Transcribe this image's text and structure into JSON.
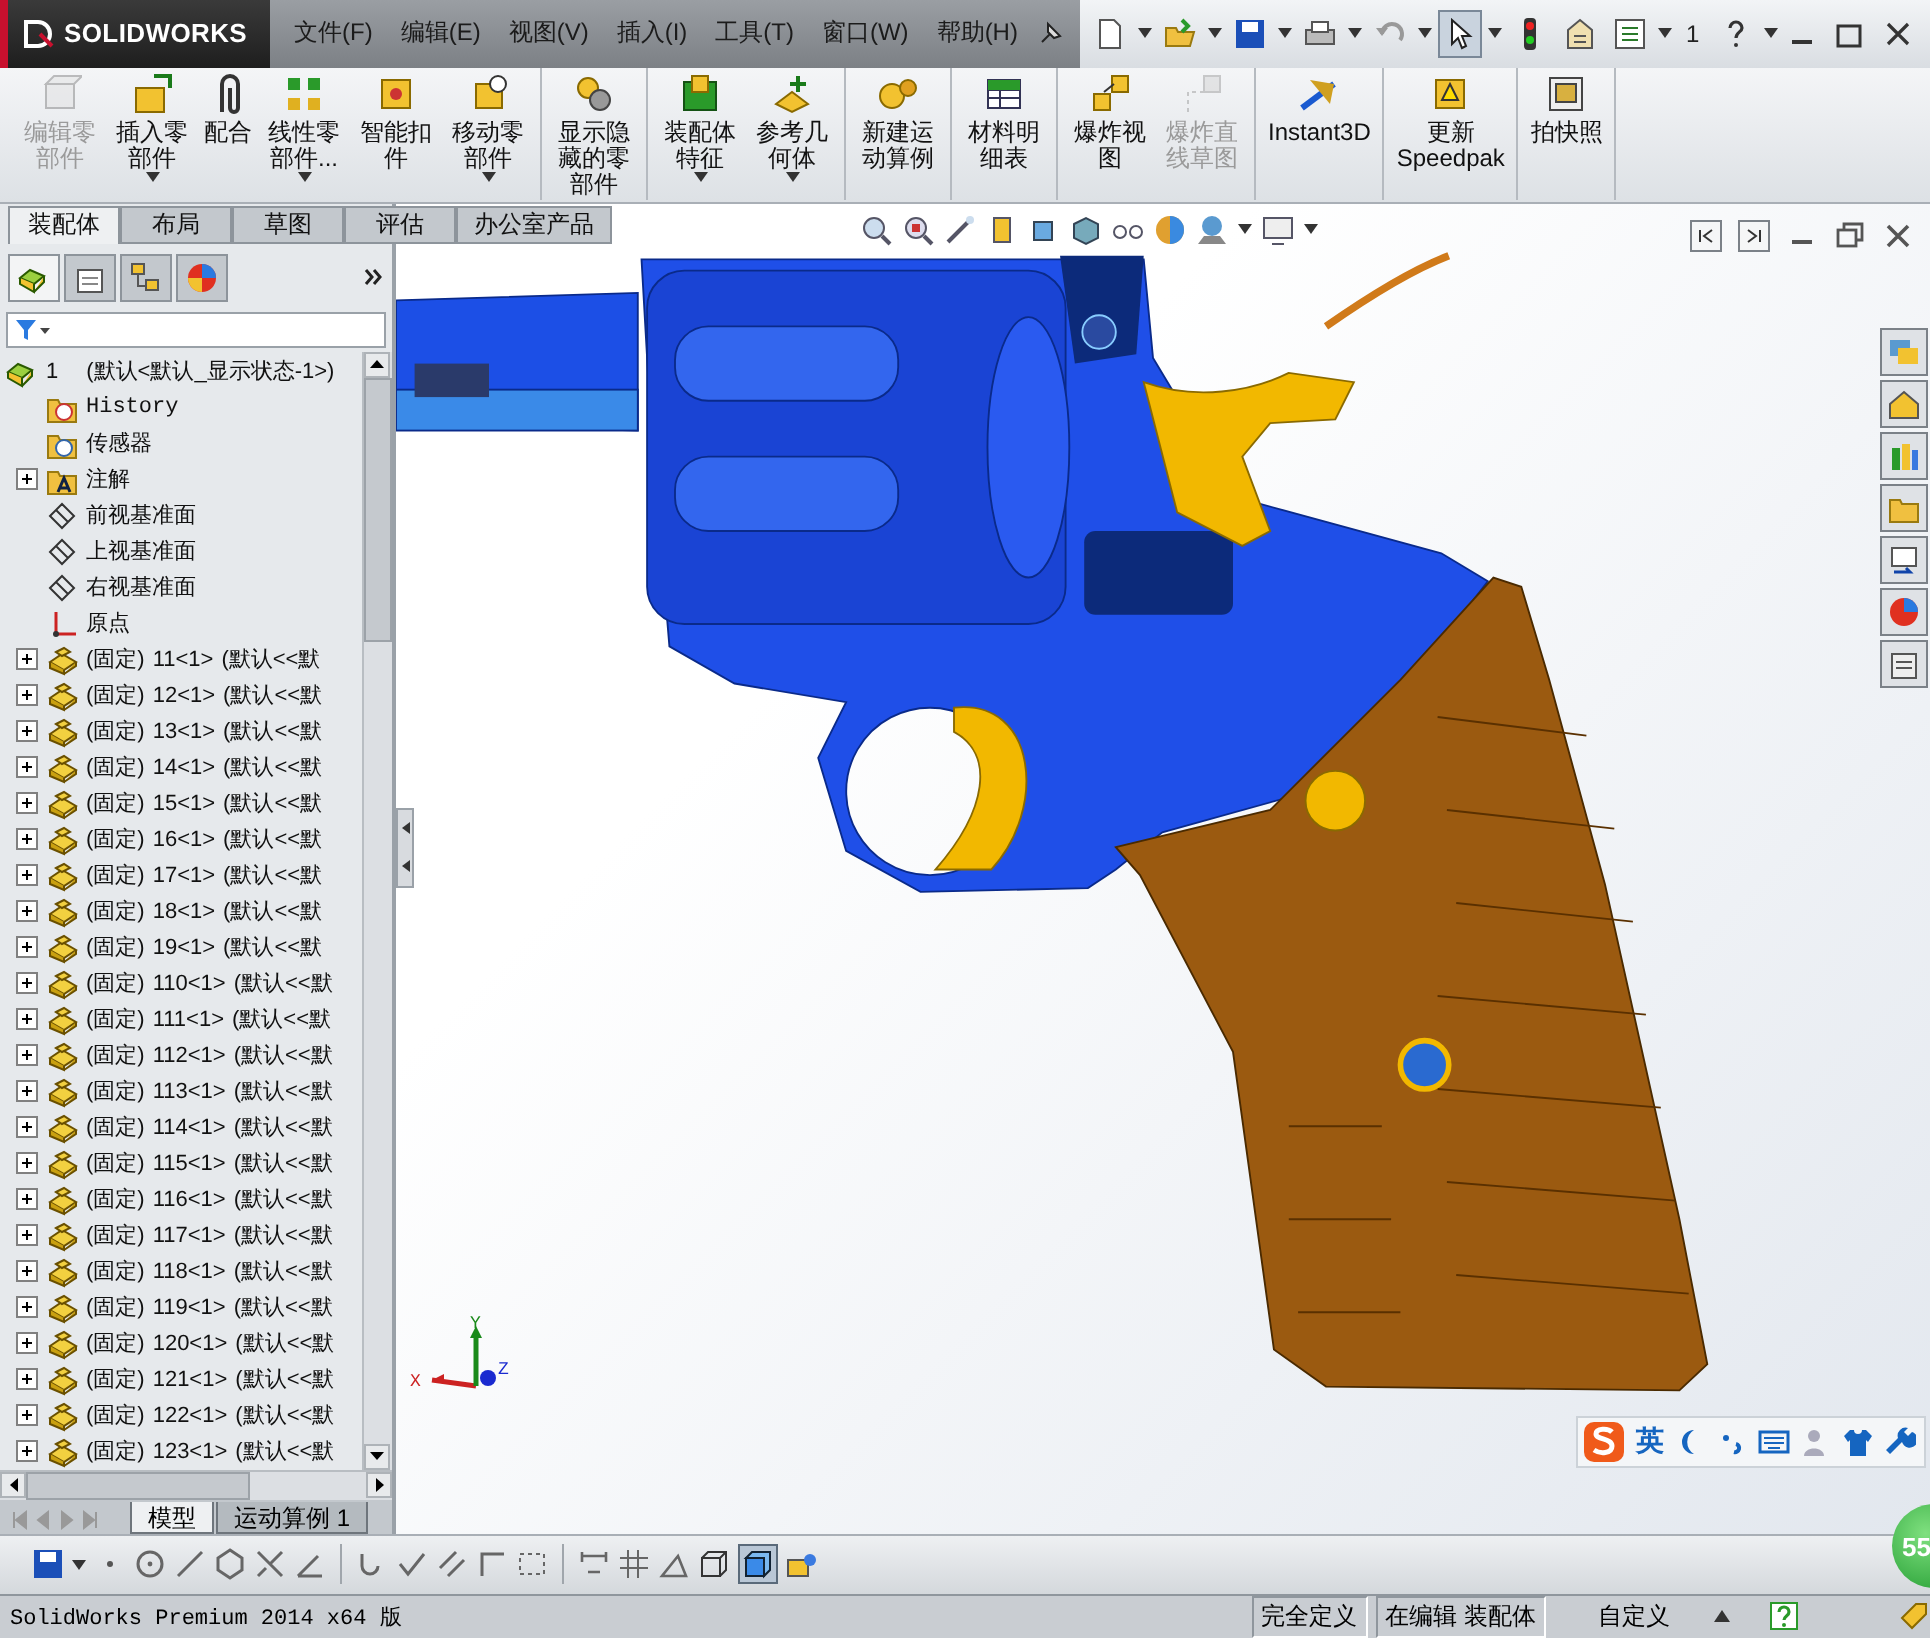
{
  "app": {
    "logo": "SOLIDWORKS"
  },
  "menus": [
    "文件(F)",
    "编辑(E)",
    "视图(V)",
    "插入(I)",
    "工具(T)",
    "窗口(W)",
    "帮助(H)"
  ],
  "quick_toolbar": {
    "select_active": true,
    "page": "1"
  },
  "command_groups": [
    [
      {
        "label": "编辑零部件",
        "disabled": true,
        "dropdown": false
      },
      {
        "label": "插入零部件",
        "disabled": false,
        "dropdown": true
      },
      {
        "label": "配合",
        "disabled": false,
        "dropdown": false
      },
      {
        "label": "线性零部件...",
        "disabled": false,
        "dropdown": true
      },
      {
        "label": "智能扣件",
        "disabled": false,
        "dropdown": false
      },
      {
        "label": "移动零部件",
        "disabled": false,
        "dropdown": true
      }
    ],
    [
      {
        "label": "显示隐藏的零部件",
        "disabled": false,
        "dropdown": false
      }
    ],
    [
      {
        "label": "装配体特征",
        "disabled": false,
        "dropdown": true
      },
      {
        "label": "参考几何体",
        "disabled": false,
        "dropdown": true
      }
    ],
    [
      {
        "label": "新建运动算例",
        "disabled": false,
        "dropdown": false
      }
    ],
    [
      {
        "label": "材料明细表",
        "disabled": false,
        "dropdown": false
      }
    ],
    [
      {
        "label": "爆炸视图",
        "disabled": false,
        "dropdown": false
      },
      {
        "label": "爆炸直线草图",
        "disabled": true,
        "dropdown": false
      }
    ],
    [
      {
        "label": "Instant3D",
        "disabled": false,
        "dropdown": false
      }
    ],
    [
      {
        "label": "更新Speedpak",
        "disabled": false,
        "dropdown": false
      }
    ],
    [
      {
        "label": "拍快照",
        "disabled": false,
        "dropdown": false
      }
    ]
  ],
  "mode_tabs": [
    {
      "label": "装配体",
      "selected": true
    },
    {
      "label": "布局",
      "selected": false
    },
    {
      "label": "草图",
      "selected": false
    },
    {
      "label": "评估",
      "selected": false
    },
    {
      "label": "办公室产品",
      "selected": false
    }
  ],
  "panel_tabs": [
    {
      "selected": true
    },
    {
      "selected": false
    },
    {
      "selected": false
    },
    {
      "selected": false
    }
  ],
  "tree": {
    "root": {
      "name": "1",
      "config": "(默认<默认_显示状态-1>)"
    },
    "items": [
      {
        "kind": "history",
        "label": "History"
      },
      {
        "kind": "sensors",
        "label": "传感器"
      },
      {
        "kind": "annotations",
        "label": "注解",
        "expanded": false
      },
      {
        "kind": "plane",
        "label": "前视基准面"
      },
      {
        "kind": "plane",
        "label": "上视基准面"
      },
      {
        "kind": "plane",
        "label": "右视基准面"
      },
      {
        "kind": "origin",
        "label": "原点"
      },
      {
        "kind": "part",
        "label": "(固定)",
        "name": "11<1>",
        "config": "(默认<<默",
        "expanded": false
      },
      {
        "kind": "part",
        "label": "(固定)",
        "name": "12<1>",
        "config": "(默认<<默",
        "expanded": false
      },
      {
        "kind": "part",
        "label": "(固定)",
        "name": "13<1>",
        "config": "(默认<<默",
        "expanded": false
      },
      {
        "kind": "part",
        "label": "(固定)",
        "name": "14<1>",
        "config": "(默认<<默",
        "expanded": false
      },
      {
        "kind": "part",
        "label": "(固定)",
        "name": "15<1>",
        "config": "(默认<<默",
        "expanded": false
      },
      {
        "kind": "part",
        "label": "(固定)",
        "name": "16<1>",
        "config": "(默认<<默",
        "expanded": false
      },
      {
        "kind": "part",
        "label": "(固定)",
        "name": "17<1>",
        "config": "(默认<<默",
        "expanded": false
      },
      {
        "kind": "part",
        "label": "(固定)",
        "name": "18<1>",
        "config": "(默认<<默",
        "expanded": false
      },
      {
        "kind": "part",
        "label": "(固定)",
        "name": "19<1>",
        "config": "(默认<<默",
        "expanded": false
      },
      {
        "kind": "part",
        "label": "(固定)",
        "name": "110<1>",
        "config": "(默认<<默",
        "expanded": false
      },
      {
        "kind": "part",
        "label": "(固定)",
        "name": "111<1>",
        "config": "(默认<<默",
        "expanded": false
      },
      {
        "kind": "part",
        "label": "(固定)",
        "name": "112<1>",
        "config": "(默认<<默",
        "expanded": false
      },
      {
        "kind": "part",
        "label": "(固定)",
        "name": "113<1>",
        "config": "(默认<<默",
        "expanded": false
      },
      {
        "kind": "part",
        "label": "(固定)",
        "name": "114<1>",
        "config": "(默认<<默",
        "expanded": false
      },
      {
        "kind": "part",
        "label": "(固定)",
        "name": "115<1>",
        "config": "(默认<<默",
        "expanded": false
      },
      {
        "kind": "part",
        "label": "(固定)",
        "name": "116<1>",
        "config": "(默认<<默",
        "expanded": false
      },
      {
        "kind": "part",
        "label": "(固定)",
        "name": "117<1>",
        "config": "(默认<<默",
        "expanded": false
      },
      {
        "kind": "part",
        "label": "(固定)",
        "name": "118<1>",
        "config": "(默认<<默",
        "expanded": false
      },
      {
        "kind": "part",
        "label": "(固定)",
        "name": "119<1>",
        "config": "(默认<<默",
        "expanded": false
      },
      {
        "kind": "part",
        "label": "(固定)",
        "name": "120<1>",
        "config": "(默认<<默",
        "expanded": false
      },
      {
        "kind": "part",
        "label": "(固定)",
        "name": "121<1>",
        "config": "(默认<<默",
        "expanded": false
      },
      {
        "kind": "part",
        "label": "(固定)",
        "name": "122<1>",
        "config": "(默认<<默",
        "expanded": false
      },
      {
        "kind": "part",
        "label": "(固定)",
        "name": "123<1>",
        "config": "(默认<<默",
        "expanded": false
      }
    ]
  },
  "bottom_tabs": [
    {
      "label": "模型",
      "selected": true
    },
    {
      "label": "运动算例 1",
      "selected": false
    }
  ],
  "triad": {
    "x": "X",
    "y": "Y",
    "z": "Z"
  },
  "ime_bar": {
    "language": "英"
  },
  "badge": {
    "text": "55"
  },
  "status_bar": {
    "product": "SolidWorks Premium 2014 x64 版",
    "fields": [
      "完全定义",
      "在编辑 装配体"
    ],
    "units": "自定义"
  }
}
